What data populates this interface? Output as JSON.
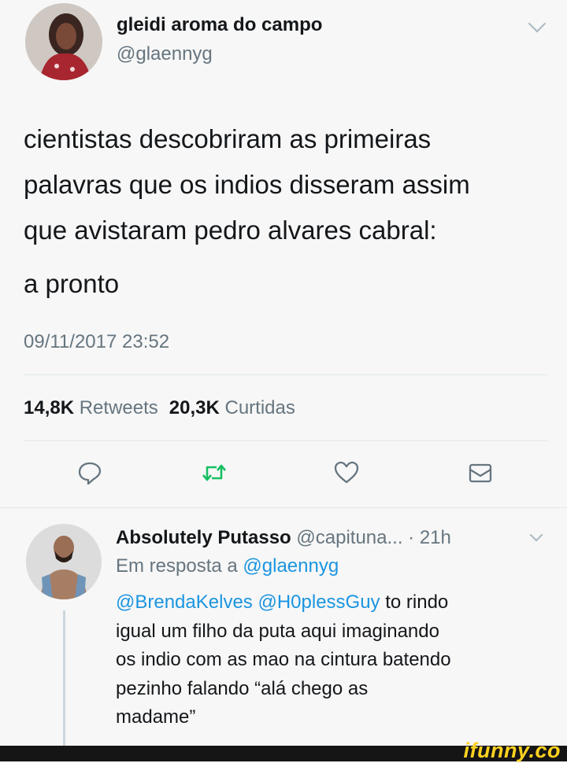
{
  "tweet": {
    "author_name": "gleidi aroma do campo",
    "author_handle": "@glaennyg",
    "lines": [
      "cientistas descobriram as primeiras",
      "palavras que os indios disseram assim",
      "que avistaram pedro alvares cabral:",
      "a pronto"
    ],
    "timestamp": "09/11/2017 23:52",
    "retweet_count": "14,8K",
    "retweet_label": "Retweets",
    "like_count": "20,3K",
    "like_label": "Curtidas"
  },
  "reply": {
    "author_name": "Absolutely Putasso",
    "author_handle": "@capituna...",
    "time": "· 21h",
    "in_reply_prefix": "Em resposta a",
    "in_reply_handle": "@glaennyg",
    "mention1": "@BrendaKelves",
    "mention2": "@H0plessGuy",
    "text_line1": " to rindo",
    "text_line2": "igual um filho da puta aqui imaginando",
    "text_line3": "os indio com as mao na cintura batendo",
    "text_line4": "pezinho falando “alá chego as",
    "text_line5": "madame”"
  },
  "watermark": "ifunny.co",
  "colors": {
    "link": "#1b95e0",
    "retweet_icon": "#17bf63",
    "secondary_text": "#66757f",
    "watermark": "#ffd21f"
  },
  "icons": [
    "reply-icon",
    "retweet-icon",
    "like-icon",
    "message-icon",
    "chevron-down-icon"
  ]
}
